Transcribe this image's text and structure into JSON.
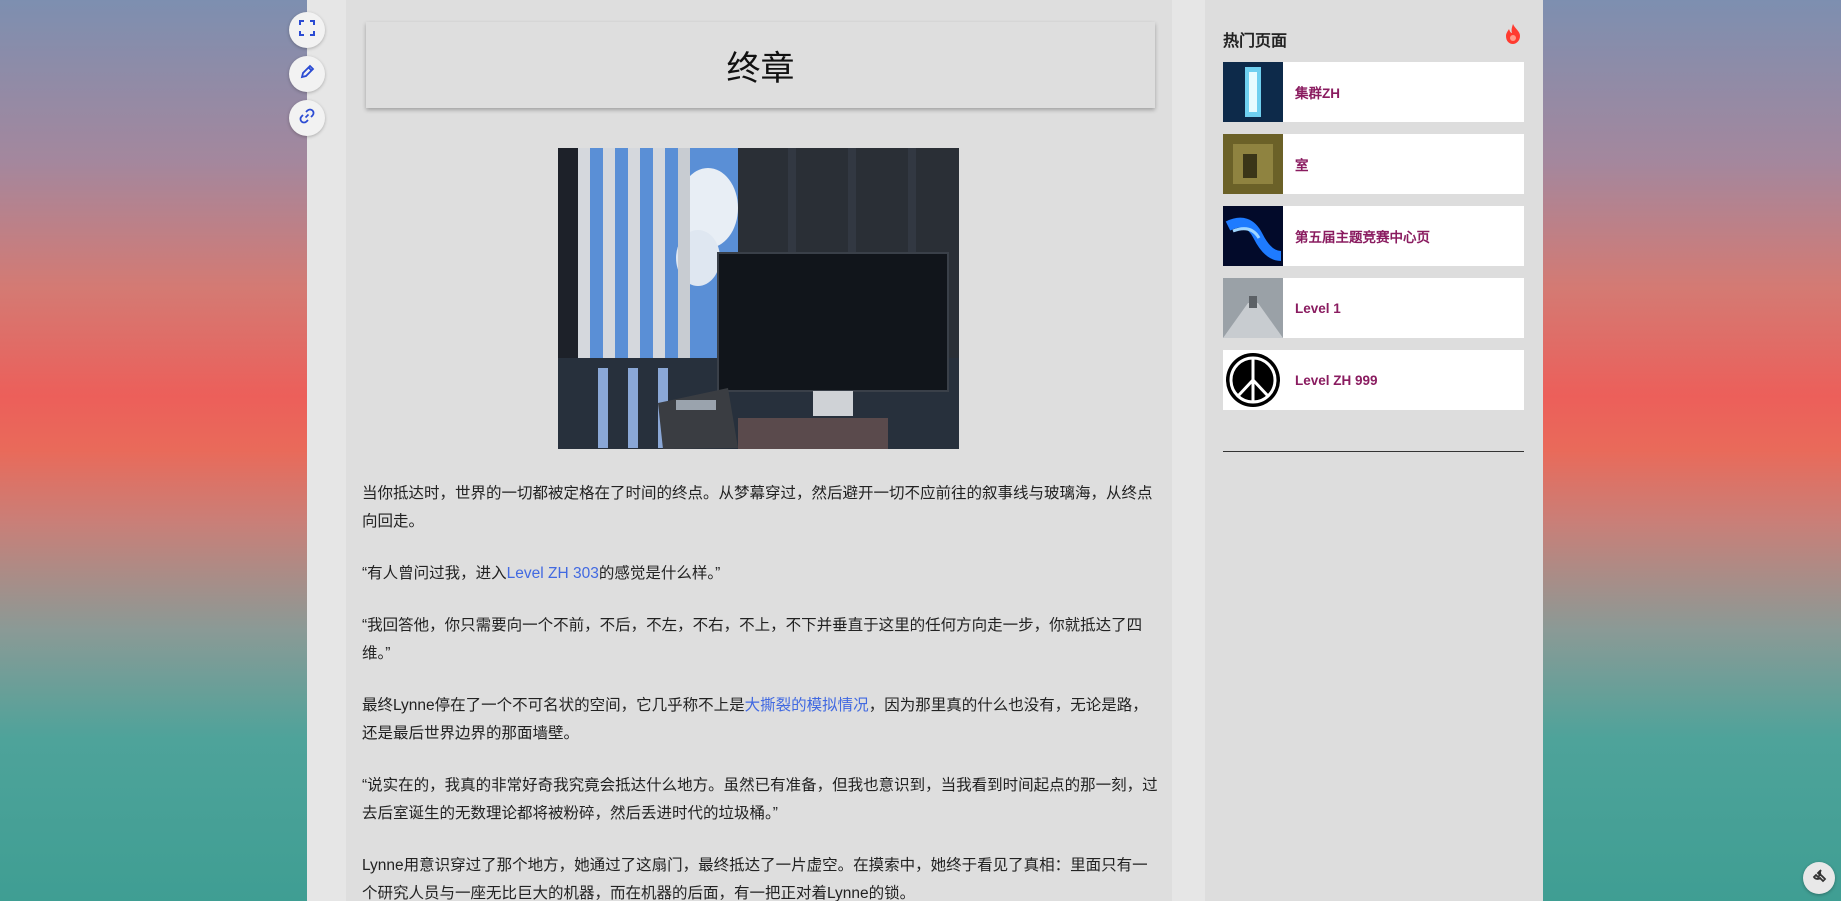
{
  "article": {
    "title": "终章",
    "paragraphs": [
      {
        "before": "当你抵达时，世界的一切都被定格在了时间的终点。从梦幕穿过，然后避开一切不应前往的叙事线与玻璃海，从终点向回走。",
        "link": "",
        "after": ""
      },
      {
        "before": "“有人曾问过我，进入",
        "link": "Level ZH 303",
        "after": "的感觉是什么样。”"
      },
      {
        "before": "“我回答他，你只需要向一个不前，不后，不左，不右，不上，不下并垂直于这里的任何方向走一步，你就抵达了四维。”",
        "link": "",
        "after": ""
      },
      {
        "before": "最终Lynne停在了一个不可名状的空间，它几乎称不上是",
        "link": "大撕裂的模拟情况",
        "after": "，因为那里真的什么也没有，无论是路，还是最后世界边界的那面墙壁。"
      },
      {
        "before": "“说实在的，我真的非常好奇我究竟会抵达什么地方。虽然已有准备，但我也意识到，当我看到时间起点的那一刻，过去后室诞生的无数理论都将被粉碎，然后丢进时代的垃圾桶。”",
        "link": "",
        "after": ""
      },
      {
        "before": "Lynne用意识穿过了那个地方，她通过了这扇门，最终抵达了一片虚空。在摸索中，她终于看见了真相：里面只有一个研究人员与一座无比巨大的机器，而在机器的后面，有一把正对着Lynne的锁。",
        "link": "",
        "after": ""
      }
    ]
  },
  "sidebar": {
    "title": "热门页面",
    "items": [
      {
        "label": "集群ZH"
      },
      {
        "label": "室"
      },
      {
        "label": "第五届主题竞赛中心页"
      },
      {
        "label": "Level 1"
      },
      {
        "label": "Level ZH 999"
      }
    ]
  },
  "tools": {
    "icons": [
      "fullscreen-icon",
      "edit-icon",
      "link-icon"
    ]
  },
  "colors": {
    "link": "#4169e1",
    "sidebar_link": "#8a1c60",
    "fire": "#ff3b30"
  }
}
